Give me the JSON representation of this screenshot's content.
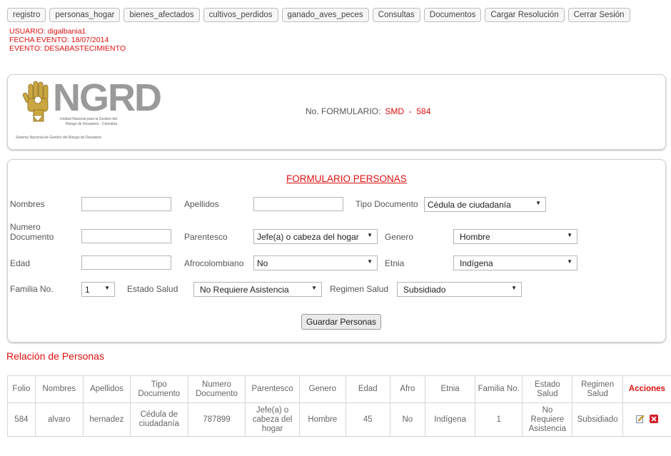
{
  "nav": {
    "tabs": [
      "registro",
      "personas_hogar",
      "bienes_afectados",
      "cultivos_perdidos",
      "ganado_aves_peces",
      "Consultas",
      "Documentos",
      "Cargar Resolución",
      "Cerrar Sesión"
    ]
  },
  "user": {
    "usuario": "USUARIO: digalbania1",
    "fecha": "FECHA EVENTO: 18/07/2014",
    "evento": "EVENTO: DESABASTECIMIENTO"
  },
  "header": {
    "logo_text": "NGRD",
    "logo_line1": "Unidad Nacional para la Gestión del",
    "logo_line2": "Riesgo de Desastres - Colombia",
    "logo_line3": "Sistema Nacional de Gestión del Riesgo de Desastres",
    "formulario_label": "No. FORMULARIO:",
    "formulario_value": "SMD  -  584"
  },
  "form": {
    "title": "FORMULARIO PERSONAS",
    "labels": {
      "nombres": "Nombres",
      "apellidos": "Apellidos",
      "tipo_documento": "Tipo Documento",
      "numero_documento_1": "Numero",
      "numero_documento_2": "Documento",
      "parentesco": "Parentesco",
      "genero": "Genero",
      "edad": "Edad",
      "afrocolombiano": "Afrocolombiano",
      "etnia": "Etnia",
      "familia": "Familia No.",
      "estado_salud": "Estado Salud",
      "regimen_salud": "Regimen Salud"
    },
    "values": {
      "tipo_documento": "Cédula de ciudadanía",
      "parentesco": "Jefe(a) o cabeza del hogar",
      "genero": "Hombre",
      "afrocolombiano": "No",
      "etnia": "Indígena",
      "familia": "1",
      "estado_salud": "No Requiere Asistencia",
      "regimen_salud": "Subsidiado"
    },
    "save_label": "Guardar Personas"
  },
  "relacion": {
    "title": "Relación de Personas",
    "headers": [
      "Folio",
      "Nombres",
      "Apellidos",
      "Tipo Documento",
      "Numero Documento",
      "Parentesco",
      "Genero",
      "Edad",
      "Afro",
      "Etnia",
      "Familia No.",
      "Estado Salud",
      "Regimen Salud",
      "Acciones"
    ],
    "rows": [
      [
        "584",
        "alvaro",
        "hernadez",
        "Cédula de ciudadanía",
        "787899",
        "Jefe(a) o cabeza del hogar",
        "Hombre",
        "45",
        "No",
        "Indígena",
        "1",
        "No Requiere Asistencia",
        "Subsidiado"
      ]
    ]
  },
  "colors": {
    "accent_red": "#e01010",
    "logo_gold": "#a0822a",
    "logo_gray": "#9a9a9a"
  },
  "icons": {
    "edit": "edit-icon",
    "delete": "delete-icon"
  }
}
